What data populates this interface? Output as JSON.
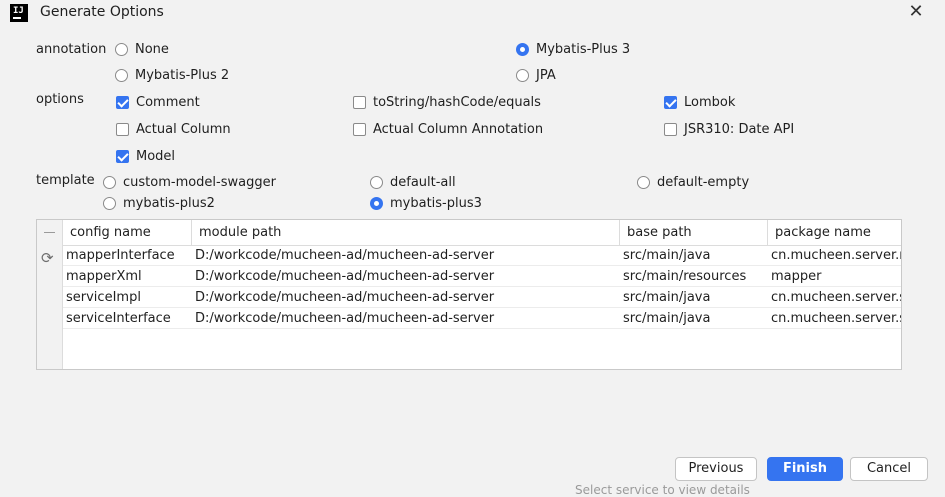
{
  "window": {
    "title": "Generate Options",
    "app_icon_text": "IJ"
  },
  "annotation": {
    "label": "annotation",
    "options": [
      "None",
      "Mybatis-Plus 3",
      "Mybatis-Plus 2",
      "JPA"
    ],
    "selected": "Mybatis-Plus 3"
  },
  "options": {
    "label": "options",
    "items": [
      {
        "label": "Comment",
        "checked": true
      },
      {
        "label": "toString/hashCode/equals",
        "checked": false
      },
      {
        "label": "Lombok",
        "checked": true
      },
      {
        "label": "Actual Column",
        "checked": false
      },
      {
        "label": "Actual Column Annotation",
        "checked": false
      },
      {
        "label": "JSR310: Date API",
        "checked": false
      },
      {
        "label": "Model",
        "checked": true
      }
    ]
  },
  "template": {
    "label": "template",
    "options": [
      "custom-model-swagger",
      "default-all",
      "default-empty",
      "mybatis-plus2",
      "mybatis-plus3"
    ],
    "selected": "mybatis-plus3"
  },
  "table": {
    "columns": [
      "config name",
      "module path",
      "base path",
      "package name"
    ],
    "rows": [
      [
        "mapperInterface",
        "D:/workcode/mucheen-ad/mucheen-ad-server",
        "src/main/java",
        "cn.mucheen.server.m"
      ],
      [
        "mapperXml",
        "D:/workcode/mucheen-ad/mucheen-ad-server",
        "src/main/resources",
        "mapper"
      ],
      [
        "serviceImpl",
        "D:/workcode/mucheen-ad/mucheen-ad-server",
        "src/main/java",
        "cn.mucheen.server.s"
      ],
      [
        "serviceInterface",
        "D:/workcode/mucheen-ad/mucheen-ad-server",
        "src/main/java",
        "cn.mucheen.server.s"
      ]
    ]
  },
  "buttons": {
    "previous": "Previous",
    "finish": "Finish",
    "cancel": "Cancel"
  },
  "status_text": "Select service to view details",
  "colors": {
    "accent": "#3574f0",
    "background": "#f2f2f2"
  }
}
